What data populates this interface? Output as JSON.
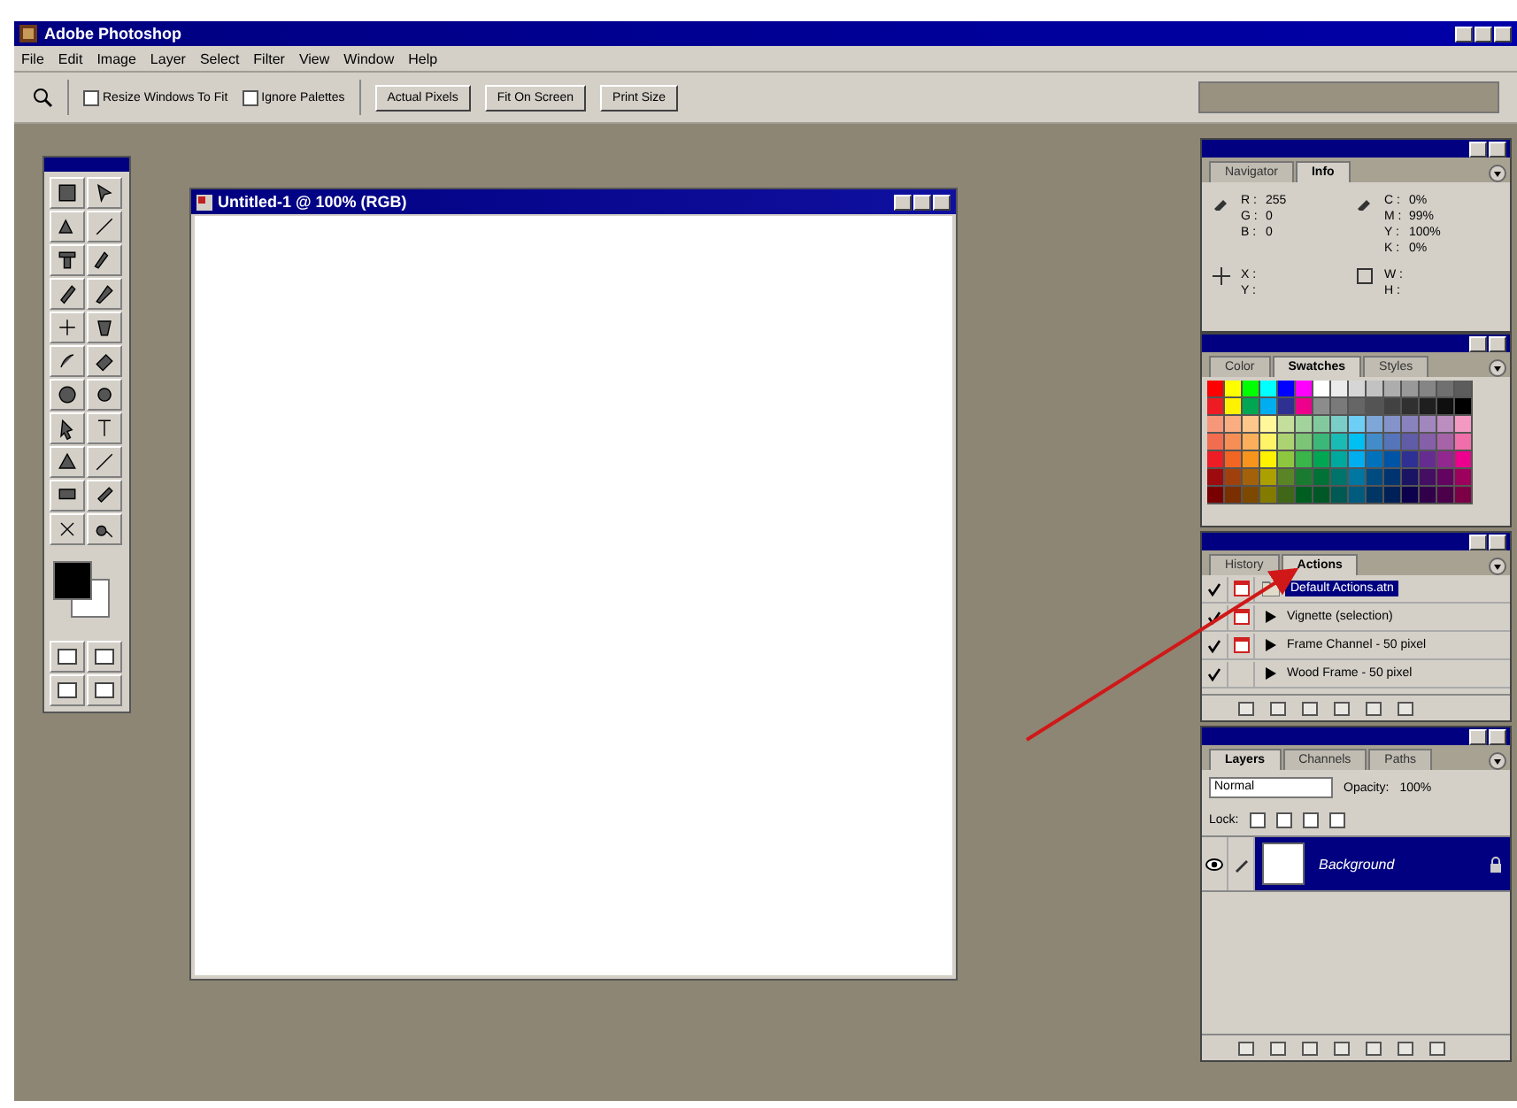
{
  "app": {
    "title": "Adobe Photoshop"
  },
  "menu": [
    "File",
    "Edit",
    "Image",
    "Layer",
    "Select",
    "Filter",
    "View",
    "Window",
    "Help"
  ],
  "options_bar": {
    "checkboxes": [
      {
        "label": "Resize Windows To Fit",
        "checked": false
      },
      {
        "label": "Ignore Palettes",
        "checked": false
      }
    ],
    "buttons": [
      "Actual Pixels",
      "Fit On Screen",
      "Print Size"
    ]
  },
  "document": {
    "title": "Untitled-1 @ 100% (RGB)"
  },
  "info_palette": {
    "tabs": [
      {
        "label": "Navigator",
        "selected": false
      },
      {
        "label": "Info",
        "selected": true
      }
    ],
    "rgb": [
      {
        "label": "R :",
        "value": "255"
      },
      {
        "label": "G :",
        "value": "0"
      },
      {
        "label": "B :",
        "value": "0"
      }
    ],
    "cmyk": [
      {
        "label": "C :",
        "value": "0%"
      },
      {
        "label": "M :",
        "value": "99%"
      },
      {
        "label": "Y :",
        "value": "100%"
      },
      {
        "label": "K :",
        "value": "0%"
      }
    ],
    "position": [
      "X :",
      "Y :"
    ],
    "size": [
      "W :",
      "H :"
    ]
  },
  "swatches_palette": {
    "tabs": [
      {
        "label": "Color",
        "selected": false
      },
      {
        "label": "Swatches",
        "selected": true
      },
      {
        "label": "Styles",
        "selected": false
      }
    ],
    "swatches": [
      {
        "color": "#ff0000"
      },
      {
        "color": "#ffff00"
      },
      {
        "color": "#00ff00"
      },
      {
        "color": "#00ffff"
      },
      {
        "color": "#0000ff"
      },
      {
        "color": "#ff00ff"
      },
      {
        "color": "#ffffff"
      },
      {
        "color": "#ebebeb"
      },
      {
        "color": "#d6d6d6"
      },
      {
        "color": "#c2c2c2"
      },
      {
        "color": "#adadad"
      },
      {
        "color": "#999999"
      },
      {
        "color": "#858585"
      },
      {
        "color": "#707070"
      },
      {
        "color": "#5c5c5c"
      },
      {
        "color": "#ed1c24"
      },
      {
        "color": "#fff200"
      },
      {
        "color": "#00a651"
      },
      {
        "color": "#00aeef"
      },
      {
        "color": "#2e3192"
      },
      {
        "color": "#ec008c"
      },
      {
        "color": "#8c8c8c"
      },
      {
        "color": "#7a7a7a"
      },
      {
        "color": "#666666"
      },
      {
        "color": "#545454"
      },
      {
        "color": "#424242"
      },
      {
        "color": "#303030"
      },
      {
        "color": "#1f1f1f"
      },
      {
        "color": "#0f0f0f"
      },
      {
        "color": "#000000"
      },
      {
        "color": "#f7977a"
      },
      {
        "color": "#f9ad81"
      },
      {
        "color": "#fdc68a"
      },
      {
        "color": "#fff79a"
      },
      {
        "color": "#c4df9b"
      },
      {
        "color": "#a3d39c"
      },
      {
        "color": "#82ca9d"
      },
      {
        "color": "#7bcdc8"
      },
      {
        "color": "#6ecff6"
      },
      {
        "color": "#7ea7d8"
      },
      {
        "color": "#8493ca"
      },
      {
        "color": "#8882be"
      },
      {
        "color": "#a187be"
      },
      {
        "color": "#bc8dbf"
      },
      {
        "color": "#f49ac2"
      },
      {
        "color": "#f26c4f"
      },
      {
        "color": "#f68e55"
      },
      {
        "color": "#fbaf5c"
      },
      {
        "color": "#fff467"
      },
      {
        "color": "#acd372"
      },
      {
        "color": "#7cc576"
      },
      {
        "color": "#3bb878"
      },
      {
        "color": "#1abbb4"
      },
      {
        "color": "#00bff3"
      },
      {
        "color": "#438cca"
      },
      {
        "color": "#5574b9"
      },
      {
        "color": "#605ca8"
      },
      {
        "color": "#855fa8"
      },
      {
        "color": "#a763a8"
      },
      {
        "color": "#f06ea9"
      },
      {
        "color": "#ed1c25"
      },
      {
        "color": "#f26522"
      },
      {
        "color": "#f7941d"
      },
      {
        "color": "#fff201"
      },
      {
        "color": "#8dc73f"
      },
      {
        "color": "#39b54a"
      },
      {
        "color": "#00a652"
      },
      {
        "color": "#00a99d"
      },
      {
        "color": "#00aef0"
      },
      {
        "color": "#0072bc"
      },
      {
        "color": "#0054a6"
      },
      {
        "color": "#2e3193"
      },
      {
        "color": "#662d91"
      },
      {
        "color": "#92278f"
      },
      {
        "color": "#ec008d"
      },
      {
        "color": "#9e0b0f"
      },
      {
        "color": "#a0410d"
      },
      {
        "color": "#a36209"
      },
      {
        "color": "#aba000"
      },
      {
        "color": "#598527"
      },
      {
        "color": "#1a7b30"
      },
      {
        "color": "#007236"
      },
      {
        "color": "#00746b"
      },
      {
        "color": "#0076a3"
      },
      {
        "color": "#004b80"
      },
      {
        "color": "#003471"
      },
      {
        "color": "#1b1464"
      },
      {
        "color": "#440e62"
      },
      {
        "color": "#630460"
      },
      {
        "color": "#9e005d"
      },
      {
        "color": "#790000"
      },
      {
        "color": "#7b2e00"
      },
      {
        "color": "#7d4900"
      },
      {
        "color": "#827b00"
      },
      {
        "color": "#406618"
      },
      {
        "color": "#005e20"
      },
      {
        "color": "#005826"
      },
      {
        "color": "#005952"
      },
      {
        "color": "#005b7f"
      },
      {
        "color": "#003663"
      },
      {
        "color": "#002157"
      },
      {
        "color": "#0d004c"
      },
      {
        "color": "#32004b"
      },
      {
        "color": "#4b0049"
      },
      {
        "color": "#7b0046"
      }
    ]
  },
  "actions_palette": {
    "tabs": [
      {
        "label": "History",
        "selected": false
      },
      {
        "label": "Actions",
        "selected": true
      }
    ],
    "rows": [
      {
        "name": "Default Actions.atn",
        "kind": "set",
        "checked": true,
        "dialog": true,
        "selected": true
      },
      {
        "name": "Vignette (selection)",
        "kind": "action",
        "checked": true,
        "dialog": true,
        "selected": false
      },
      {
        "name": "Frame Channel - 50 pixel",
        "kind": "action",
        "checked": true,
        "dialog": true,
        "selected": false
      },
      {
        "name": "Wood Frame - 50 pixel",
        "kind": "action",
        "checked": true,
        "dialog": false,
        "selected": false
      }
    ]
  },
  "layers_palette": {
    "tabs": [
      {
        "label": "Layers",
        "selected": true
      },
      {
        "label": "Channels",
        "selected": false
      },
      {
        "label": "Paths",
        "selected": false
      }
    ],
    "blend_mode": "Normal",
    "opacity_label": "Opacity:",
    "opacity": "100%",
    "lock_label": "Lock:",
    "layers": [
      {
        "name": "Background",
        "visible": true,
        "selected": true,
        "locked": true
      }
    ]
  }
}
